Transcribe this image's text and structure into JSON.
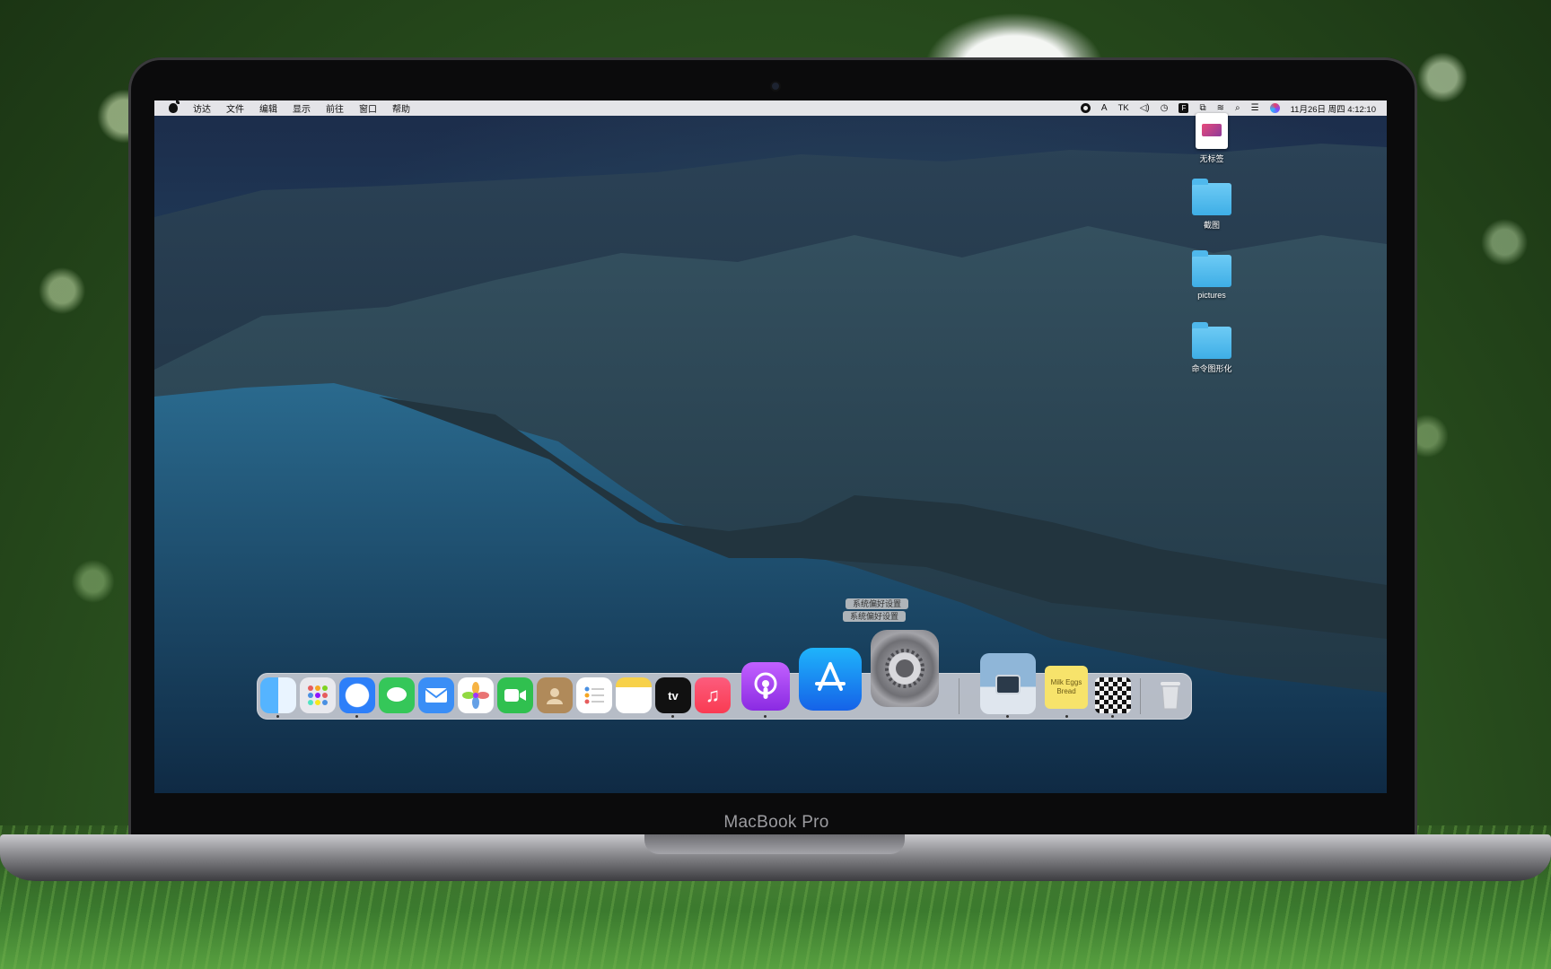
{
  "menubar": {
    "items": [
      "访达",
      "文件",
      "编辑",
      "显示",
      "前往",
      "窗口",
      "帮助"
    ],
    "status_tk": "TK",
    "datetime": "11月26日 周四 4:12:10"
  },
  "desktop_icons": [
    {
      "label": "无标签"
    },
    {
      "label": "截图"
    },
    {
      "label": "pictures"
    },
    {
      "label": "命令图形化"
    }
  ],
  "dock": {
    "tooltip": "系统偏好设置",
    "apps": [
      {
        "name": "finder-icon",
        "color": "#2a8cf0"
      },
      {
        "name": "launchpad-icon",
        "color": "#e9e9ee"
      },
      {
        "name": "safari-icon",
        "color": "#2d7ff9"
      },
      {
        "name": "messages-icon",
        "color": "#35c759"
      },
      {
        "name": "mail-icon",
        "color": "#3a8ef6"
      },
      {
        "name": "photos-icon",
        "color": "#ffffff"
      },
      {
        "name": "facetime-icon",
        "color": "#30c04f"
      },
      {
        "name": "contacts-icon",
        "color": "#b08a5a"
      },
      {
        "name": "reminders-icon",
        "color": "#ffffff"
      },
      {
        "name": "notes-icon",
        "color": "#f7d14a"
      },
      {
        "name": "appletv-icon",
        "color": "#111111"
      },
      {
        "name": "music-icon",
        "color": "#fa3b52"
      },
      {
        "name": "podcasts-icon",
        "color": "#9b3ff0"
      },
      {
        "name": "appstore-icon",
        "color": "#1e8df5"
      },
      {
        "name": "system-preferences-icon",
        "color": "#8e8e93"
      }
    ],
    "appletv_label": "tv",
    "stickies_text": "Milk Eggs Bread"
  },
  "laptop": {
    "brand": "MacBook Pro"
  }
}
